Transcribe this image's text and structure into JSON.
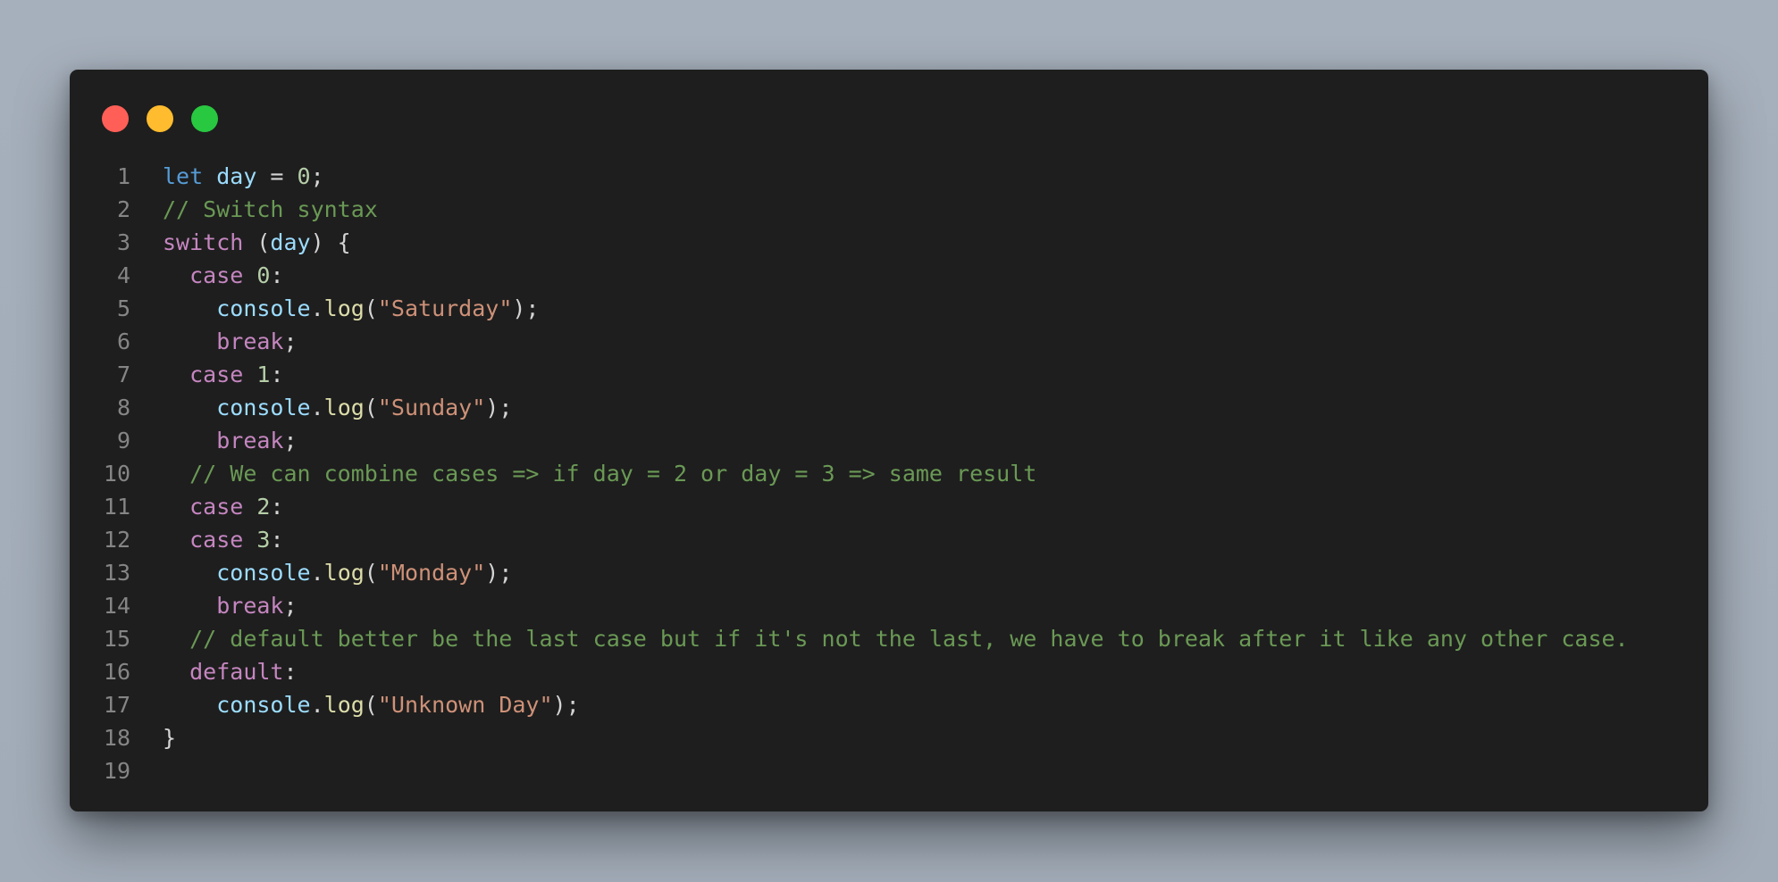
{
  "colors": {
    "background": "#a6b0bc",
    "editor_bg": "#1e1e1e",
    "line_number": "#858585",
    "keyword": "#569cd6",
    "control": "#c586c0",
    "variable": "#9cdcfe",
    "number": "#b5cea8",
    "string": "#ce9178",
    "function": "#dcdcaa",
    "comment": "#6a9955",
    "punct": "#d4d4d4"
  },
  "window_controls": [
    {
      "name": "close-dot",
      "color": "#ff5f57"
    },
    {
      "name": "minimize-dot",
      "color": "#febc2e"
    },
    {
      "name": "maximize-dot",
      "color": "#28c840"
    }
  ],
  "lines": [
    {
      "n": "1",
      "tokens": [
        {
          "t": "let",
          "c": "keyword"
        },
        {
          "t": " ",
          "c": "punct"
        },
        {
          "t": "day",
          "c": "variable"
        },
        {
          "t": " = ",
          "c": "punct"
        },
        {
          "t": "0",
          "c": "number"
        },
        {
          "t": ";",
          "c": "punct"
        }
      ]
    },
    {
      "n": "2",
      "tokens": [
        {
          "t": "// Switch syntax",
          "c": "comment"
        }
      ]
    },
    {
      "n": "3",
      "tokens": [
        {
          "t": "switch",
          "c": "control"
        },
        {
          "t": " (",
          "c": "punct"
        },
        {
          "t": "day",
          "c": "variable"
        },
        {
          "t": ") {",
          "c": "punct"
        }
      ]
    },
    {
      "n": "4",
      "tokens": [
        {
          "t": "  ",
          "c": "punct"
        },
        {
          "t": "case",
          "c": "control"
        },
        {
          "t": " ",
          "c": "punct"
        },
        {
          "t": "0",
          "c": "number"
        },
        {
          "t": ":",
          "c": "punct"
        }
      ]
    },
    {
      "n": "5",
      "tokens": [
        {
          "t": "    ",
          "c": "punct"
        },
        {
          "t": "console",
          "c": "variable"
        },
        {
          "t": ".",
          "c": "punct"
        },
        {
          "t": "log",
          "c": "function"
        },
        {
          "t": "(",
          "c": "punct"
        },
        {
          "t": "\"Saturday\"",
          "c": "string"
        },
        {
          "t": ");",
          "c": "punct"
        }
      ]
    },
    {
      "n": "6",
      "tokens": [
        {
          "t": "    ",
          "c": "punct"
        },
        {
          "t": "break",
          "c": "control"
        },
        {
          "t": ";",
          "c": "punct"
        }
      ]
    },
    {
      "n": "7",
      "tokens": [
        {
          "t": "  ",
          "c": "punct"
        },
        {
          "t": "case",
          "c": "control"
        },
        {
          "t": " ",
          "c": "punct"
        },
        {
          "t": "1",
          "c": "number"
        },
        {
          "t": ":",
          "c": "punct"
        }
      ]
    },
    {
      "n": "8",
      "tokens": [
        {
          "t": "    ",
          "c": "punct"
        },
        {
          "t": "console",
          "c": "variable"
        },
        {
          "t": ".",
          "c": "punct"
        },
        {
          "t": "log",
          "c": "function"
        },
        {
          "t": "(",
          "c": "punct"
        },
        {
          "t": "\"Sunday\"",
          "c": "string"
        },
        {
          "t": ");",
          "c": "punct"
        }
      ]
    },
    {
      "n": "9",
      "tokens": [
        {
          "t": "    ",
          "c": "punct"
        },
        {
          "t": "break",
          "c": "control"
        },
        {
          "t": ";",
          "c": "punct"
        }
      ]
    },
    {
      "n": "10",
      "tokens": [
        {
          "t": "  ",
          "c": "punct"
        },
        {
          "t": "// We can combine cases => if day = 2 or day = 3 => same result",
          "c": "comment"
        }
      ]
    },
    {
      "n": "11",
      "tokens": [
        {
          "t": "  ",
          "c": "punct"
        },
        {
          "t": "case",
          "c": "control"
        },
        {
          "t": " ",
          "c": "punct"
        },
        {
          "t": "2",
          "c": "number"
        },
        {
          "t": ":",
          "c": "punct"
        }
      ]
    },
    {
      "n": "12",
      "tokens": [
        {
          "t": "  ",
          "c": "punct"
        },
        {
          "t": "case",
          "c": "control"
        },
        {
          "t": " ",
          "c": "punct"
        },
        {
          "t": "3",
          "c": "number"
        },
        {
          "t": ":",
          "c": "punct"
        }
      ]
    },
    {
      "n": "13",
      "tokens": [
        {
          "t": "    ",
          "c": "punct"
        },
        {
          "t": "console",
          "c": "variable"
        },
        {
          "t": ".",
          "c": "punct"
        },
        {
          "t": "log",
          "c": "function"
        },
        {
          "t": "(",
          "c": "punct"
        },
        {
          "t": "\"Monday\"",
          "c": "string"
        },
        {
          "t": ");",
          "c": "punct"
        }
      ]
    },
    {
      "n": "14",
      "tokens": [
        {
          "t": "    ",
          "c": "punct"
        },
        {
          "t": "break",
          "c": "control"
        },
        {
          "t": ";",
          "c": "punct"
        }
      ]
    },
    {
      "n": "15",
      "tokens": [
        {
          "t": "  ",
          "c": "punct"
        },
        {
          "t": "// default better be the last case but if it's not the last, we have to break after it like any other case.",
          "c": "comment"
        }
      ]
    },
    {
      "n": "16",
      "tokens": [
        {
          "t": "  ",
          "c": "punct"
        },
        {
          "t": "default",
          "c": "control"
        },
        {
          "t": ":",
          "c": "punct"
        }
      ]
    },
    {
      "n": "17",
      "tokens": [
        {
          "t": "    ",
          "c": "punct"
        },
        {
          "t": "console",
          "c": "variable"
        },
        {
          "t": ".",
          "c": "punct"
        },
        {
          "t": "log",
          "c": "function"
        },
        {
          "t": "(",
          "c": "punct"
        },
        {
          "t": "\"Unknown Day\"",
          "c": "string"
        },
        {
          "t": ");",
          "c": "punct"
        }
      ]
    },
    {
      "n": "18",
      "tokens": [
        {
          "t": "}",
          "c": "punct"
        }
      ]
    },
    {
      "n": "19",
      "tokens": []
    }
  ]
}
